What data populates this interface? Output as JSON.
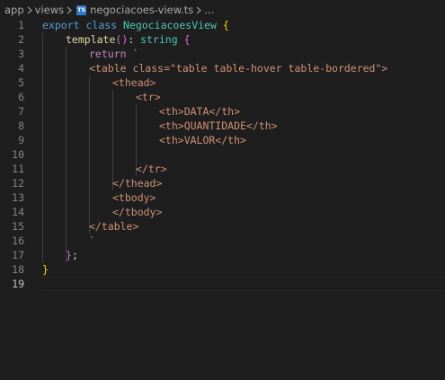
{
  "breadcrumb": {
    "items": [
      "app",
      "views"
    ],
    "file_icon_label": "TS",
    "file_name": "negociacoes-view.ts",
    "ellipsis": "..."
  },
  "lines": [
    {
      "n": "1",
      "tokens": [
        [
          "kw",
          "export"
        ],
        [
          "pl",
          " "
        ],
        [
          "kw",
          "class"
        ],
        [
          "pl",
          " "
        ],
        [
          "cls",
          "NegociacoesView"
        ],
        [
          "pl",
          " "
        ],
        [
          "br1",
          "{"
        ]
      ]
    },
    {
      "n": "2",
      "tokens": [
        [
          "fn",
          "template"
        ],
        [
          "br2",
          "()"
        ],
        [
          "pl",
          ": "
        ],
        [
          "cls",
          "string"
        ],
        [
          "pl",
          " "
        ],
        [
          "br2",
          "{"
        ]
      ]
    },
    {
      "n": "3",
      "tokens": [
        [
          "ctl",
          "return"
        ],
        [
          "pl",
          " "
        ],
        [
          "str",
          "`"
        ]
      ]
    },
    {
      "n": "4",
      "tokens": [
        [
          "str",
          "<table class=\"table table-hover table-bordered\">"
        ]
      ]
    },
    {
      "n": "5",
      "tokens": [
        [
          "str",
          "<thead>"
        ]
      ]
    },
    {
      "n": "6",
      "tokens": [
        [
          "str",
          "<tr>"
        ]
      ]
    },
    {
      "n": "7",
      "tokens": [
        [
          "str",
          "<th>DATA</th>"
        ]
      ]
    },
    {
      "n": "8",
      "tokens": [
        [
          "str",
          "<th>QUANTIDADE</th>"
        ]
      ]
    },
    {
      "n": "9",
      "tokens": [
        [
          "str",
          "<th>VALOR</th>"
        ]
      ]
    },
    {
      "n": "10",
      "tokens": []
    },
    {
      "n": "11",
      "tokens": [
        [
          "str",
          "</tr>"
        ]
      ]
    },
    {
      "n": "12",
      "tokens": [
        [
          "str",
          "</thead>"
        ]
      ]
    },
    {
      "n": "13",
      "tokens": [
        [
          "str",
          "<tbody>"
        ]
      ]
    },
    {
      "n": "14",
      "tokens": [
        [
          "str",
          "</tbody>"
        ]
      ]
    },
    {
      "n": "15",
      "tokens": [
        [
          "str",
          "</table>"
        ]
      ]
    },
    {
      "n": "16",
      "tokens": [
        [
          "str",
          "`"
        ]
      ]
    },
    {
      "n": "17",
      "tokens": [
        [
          "br2",
          "}"
        ],
        [
          "pl",
          ";"
        ]
      ]
    },
    {
      "n": "18",
      "tokens": [
        [
          "br1",
          "}"
        ]
      ]
    },
    {
      "n": "19",
      "tokens": []
    }
  ],
  "current_line": "19",
  "colors": {
    "background": "#1e1e1e",
    "keyword": "#569cd6",
    "control": "#c586c0",
    "class": "#4ec9b0",
    "function": "#dcdcaa",
    "string": "#ce9178",
    "bracket_level1": "#ffd700",
    "bracket_level2": "#da70d6",
    "line_number": "#858585"
  }
}
